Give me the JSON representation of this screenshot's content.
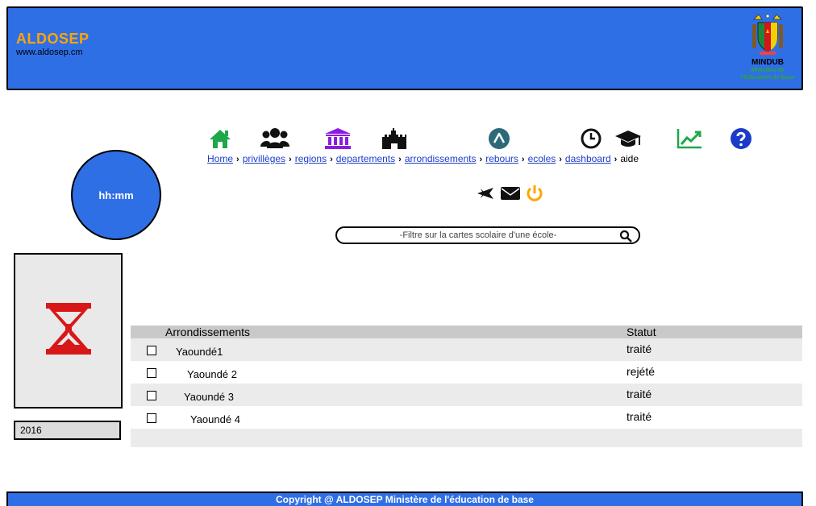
{
  "header": {
    "brand_name": "ALDOSEP",
    "brand_url": "www.aldosep.cm",
    "ministry_code": "MINDUB",
    "ministry_name_line1": "Ministère de",
    "ministry_name_line2": "l'Education de Base"
  },
  "nav": {
    "items": [
      {
        "label": "Home",
        "icon": "home-icon"
      },
      {
        "label": "privillèges",
        "icon": "users-icon"
      },
      {
        "label": "regions",
        "icon": "university-icon"
      },
      {
        "label": "departements",
        "icon": "castle-icon"
      },
      {
        "label": "arrondissements",
        "icon": "arrow-up-circle-icon"
      },
      {
        "label": "rebours",
        "icon": "clock-icon"
      },
      {
        "label": "ecoles",
        "icon": "graduation-cap-icon"
      },
      {
        "label": "dashboard",
        "icon": "line-chart-icon"
      },
      {
        "label": "aide",
        "icon": "question-circle-icon"
      }
    ]
  },
  "tools": {
    "icons": [
      "plane-icon",
      "envelope-icon",
      "power-icon"
    ]
  },
  "clock": {
    "label": "hh:mm"
  },
  "search": {
    "placeholder": "-Filtre sur la cartes scolaire d'une école-"
  },
  "year": {
    "value": "2016"
  },
  "table": {
    "headers": {
      "name": "Arrondissements",
      "status": "Statut"
    },
    "rows": [
      {
        "name": "Yaoundé1",
        "status": "traité"
      },
      {
        "name": "Yaoundé 2",
        "status": "rejété"
      },
      {
        "name": "Yaoundé 3",
        "status": "traité"
      },
      {
        "name": "Yaoundé 4",
        "status": "traité"
      }
    ]
  },
  "footer": {
    "text": "Copyright  @  ALDOSEP Ministère de l'éducation de base"
  },
  "colors": {
    "primary": "#2f6fe6",
    "brand": "#ffa500",
    "home": "#1ea84a",
    "regions": "#8a1ce0",
    "arrondissements": "#2c6a7a",
    "dashboard": "#1ea84a",
    "power": "#ffa500",
    "hourglass": "#d81818"
  }
}
